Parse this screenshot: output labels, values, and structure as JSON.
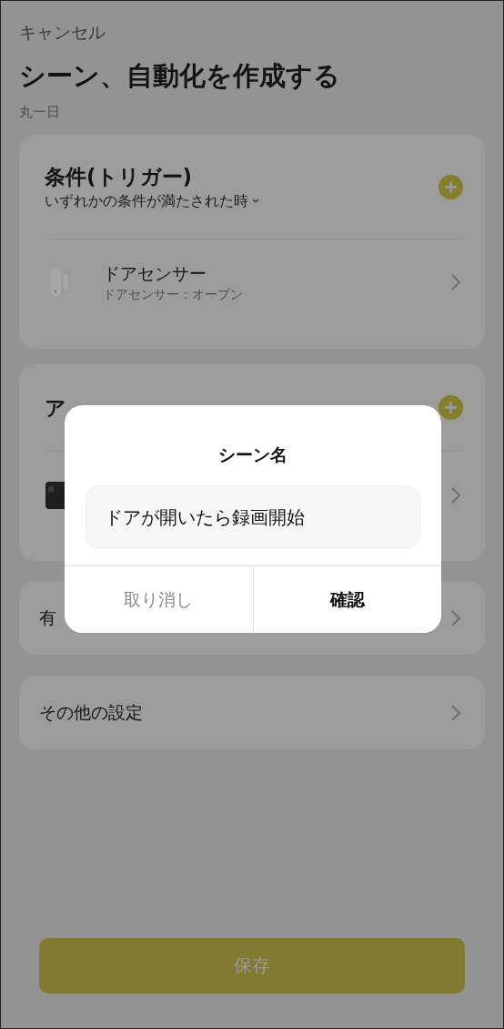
{
  "header": {
    "cancel": "キャンセル",
    "title": "シーン、自動化を作成する",
    "subtitle": "丸一日"
  },
  "conditions": {
    "title": "条件(トリガー)",
    "mode": "いずれかの条件が満たされた時",
    "items": [
      {
        "name": "ドアセンサー",
        "detail": "ドアセンサー : オープン"
      }
    ]
  },
  "actions": {
    "title": "ア"
  },
  "rows": [
    {
      "label": "有"
    },
    {
      "label": "その他の設定"
    }
  ],
  "save_button": "保存",
  "dialog": {
    "title": "シーン名",
    "value": "ドアが開いたら録画開始",
    "buttons": [
      {
        "label": "取り消し",
        "kind": "cancel"
      },
      {
        "label": "確認",
        "kind": "confirm"
      }
    ]
  }
}
